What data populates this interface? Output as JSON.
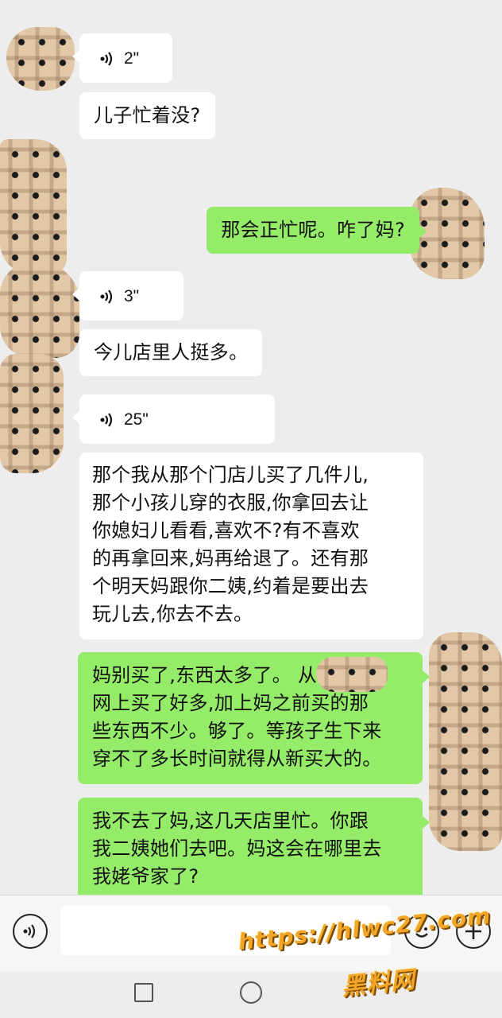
{
  "messages": [
    {
      "side": "left",
      "type": "voice",
      "duration": "2\""
    },
    {
      "side": "left",
      "type": "text",
      "text": "儿子忙着没?"
    },
    {
      "side": "right",
      "type": "text",
      "text": "那会正忙呢。咋了妈?"
    },
    {
      "side": "left",
      "type": "voice",
      "duration": "3\""
    },
    {
      "side": "left",
      "type": "text",
      "text": "今儿店里人挺多。"
    },
    {
      "side": "left",
      "type": "voice",
      "duration": "25\""
    },
    {
      "side": "left",
      "type": "text",
      "text": "那个我从那个门店儿买了几件儿,\n那个小孩儿穿的衣服,你拿回去让\n你媳妇儿看看,喜欢不?有不喜欢\n的再拿回来,妈再给退了。还有那\n个明天妈跟你二姨,约着是要出去\n玩儿去,你去不去。"
    },
    {
      "side": "right",
      "type": "text",
      "text": "妈别买了,东西太多了。           从\n网上买了好多,加上妈之前买的那\n些东西不少。够了。等孩子生下来\n穿不了多长时间就得从新买大的。"
    },
    {
      "side": "right",
      "type": "text",
      "text": "我不去了妈,这几天店里忙。你跟\n我二姨她们去吧。妈这会在哪里去\n我姥爷家了?"
    }
  ],
  "input_bar": {
    "voice_toggle_icon": "voice-mode-icon",
    "emoji_icon": "emoji-icon",
    "more_icon": "plus-icon"
  },
  "nav_bar": {
    "recents_icon": "square-icon",
    "home_icon": "circle-icon"
  },
  "watermark": {
    "line1": "https://hlwc27.com",
    "line2": "黑料网"
  },
  "colors": {
    "chat_background": "#ededed",
    "incoming_bubble": "#ffffff",
    "outgoing_bubble": "#95ec69",
    "watermark": "#f2a527"
  }
}
